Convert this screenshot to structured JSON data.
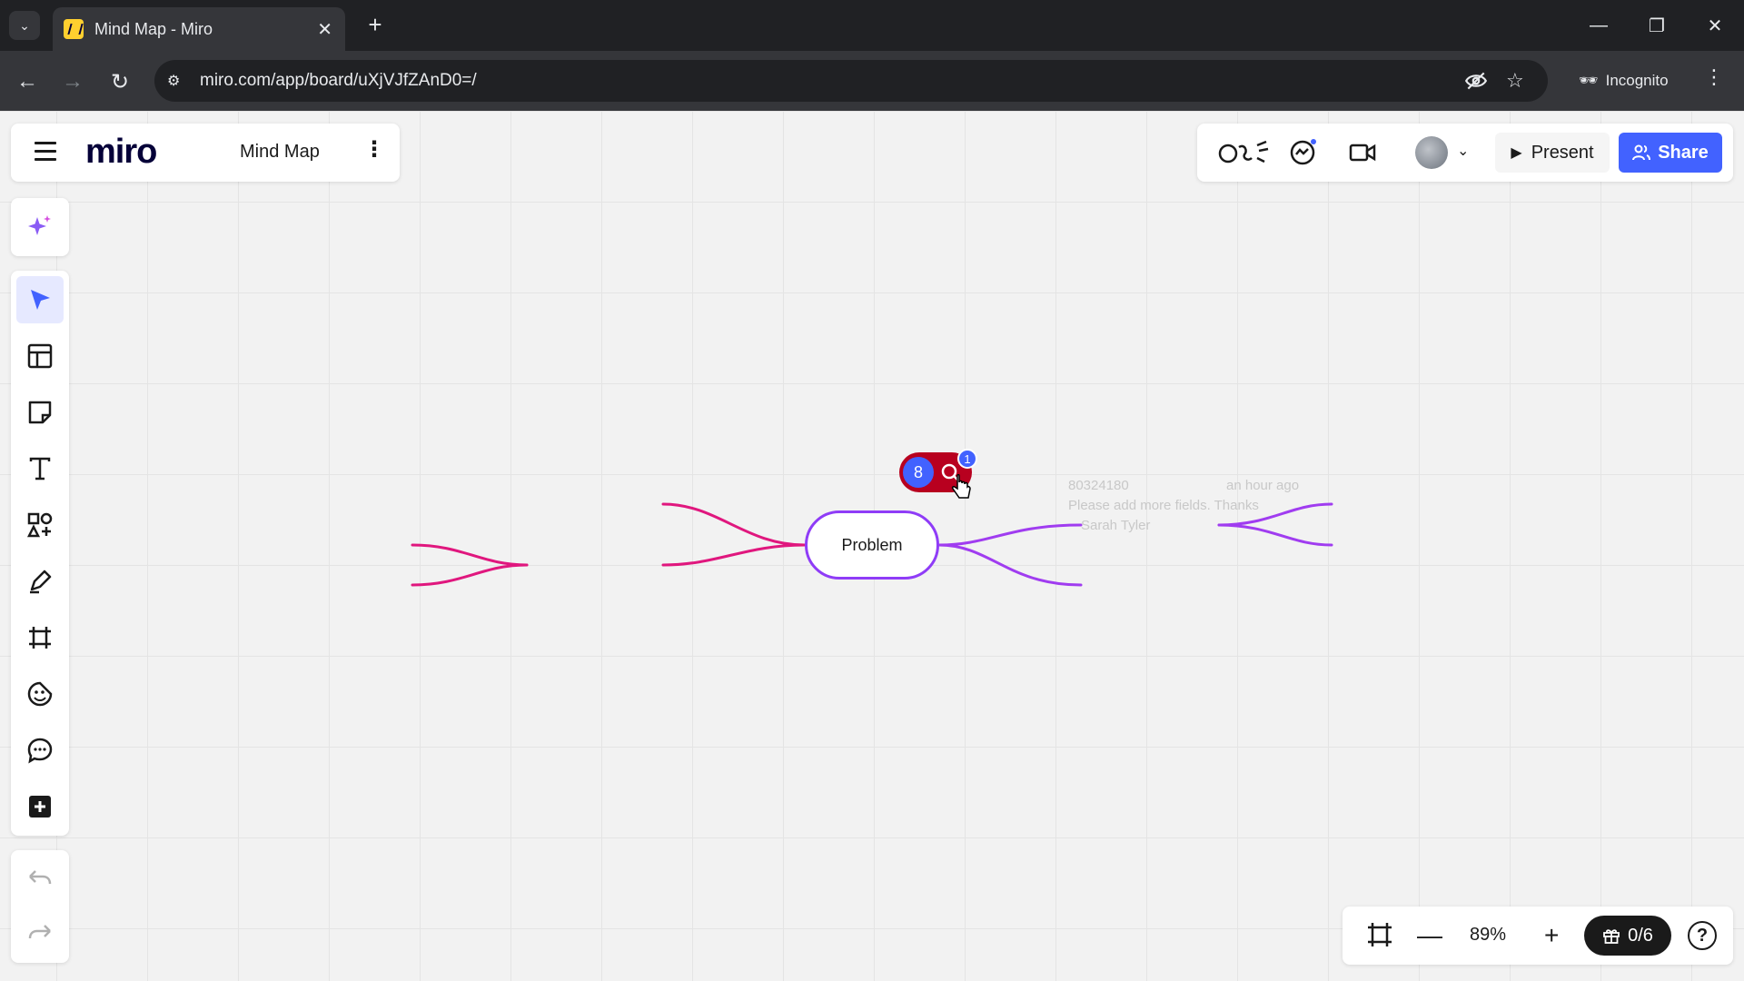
{
  "browser": {
    "tab_title": "Mind Map - Miro",
    "url": "miro.com/app/board/uXjVJfZAnD0=/",
    "incognito_label": "Incognito"
  },
  "board": {
    "logo": "miro",
    "name": "Mind Map"
  },
  "header": {
    "present_label": "Present",
    "share_label": "Share"
  },
  "canvas": {
    "central_node": "Problem",
    "comment_count": "8",
    "notification_count": "1",
    "faded_comment": {
      "author_id": "80324180",
      "time": "an hour ago",
      "text": "Please add more fields. Thanks",
      "name": "Sarah Tyler"
    }
  },
  "bottom_bar": {
    "zoom": "89%",
    "gift_label": "0/6",
    "help_label": "?"
  },
  "colors": {
    "accent": "#4262ff",
    "branch_left": "#e0177e",
    "branch_right": "#a03cf0",
    "node_border": "#8f3cf7",
    "comment_badge": "#b8001f"
  }
}
